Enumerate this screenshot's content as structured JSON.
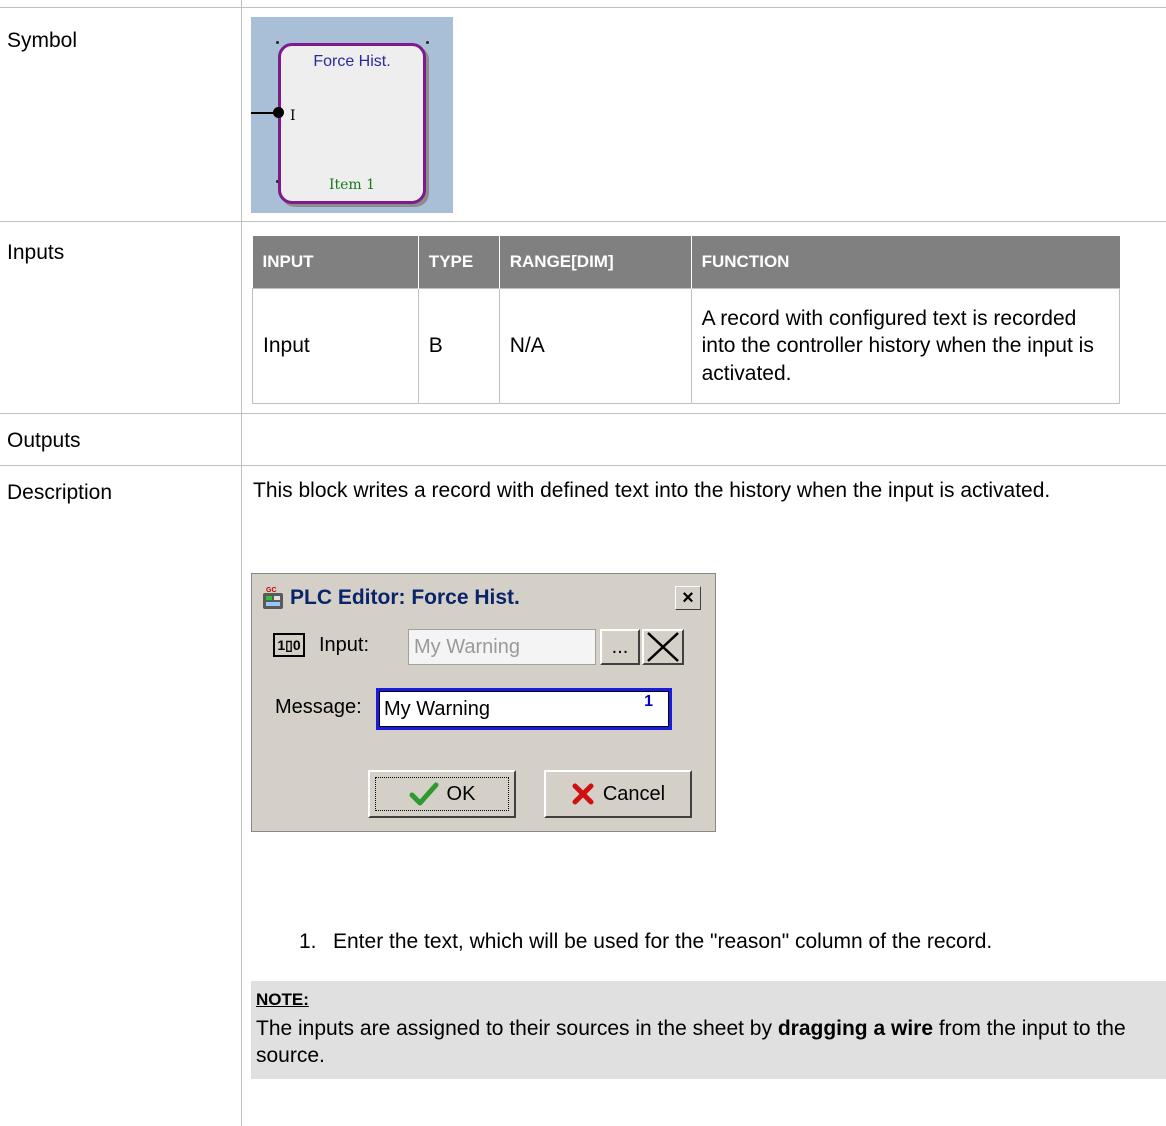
{
  "rows": {
    "symbol": "Symbol",
    "inputs": "Inputs",
    "outputs": "Outputs",
    "description": "Description"
  },
  "symbol_block": {
    "title": "Force Hist.",
    "pin": "I",
    "item": "Item 1"
  },
  "inputs_table": {
    "headers": [
      {
        "first": "I",
        "rest": "NPUT"
      },
      {
        "first": "T",
        "rest": "YPE"
      },
      {
        "first": "R",
        "rest": "ANGE[DIM]"
      },
      {
        "first": "F",
        "rest": "UNCTION"
      }
    ],
    "row": {
      "input": "Input",
      "type": "B",
      "range": "N/A",
      "function": "A record with configured text is recorded into the controller history when the input is activated."
    }
  },
  "description": {
    "text": "This block writes a record with defined text into the history when the input is activated.",
    "dialog": {
      "title": "PLC Editor: Force Hist.",
      "close": "×",
      "input_label": "Input:",
      "input_value": "My Warning",
      "browse": "...",
      "message_label": "Message:",
      "message_value": "My Warning",
      "message_count": "1",
      "ok": "OK",
      "cancel": "Cancel",
      "input_icon_text": "1▯0"
    },
    "step_number": "1.",
    "step_text": "Enter the text, which will be used for the \"reason\" column of the record.",
    "note_title": "NOTE:",
    "note_pre": "The inputs are assigned to their sources in the sheet by ",
    "note_bold": "dragging a wire",
    "note_post": " from the input to the source."
  }
}
